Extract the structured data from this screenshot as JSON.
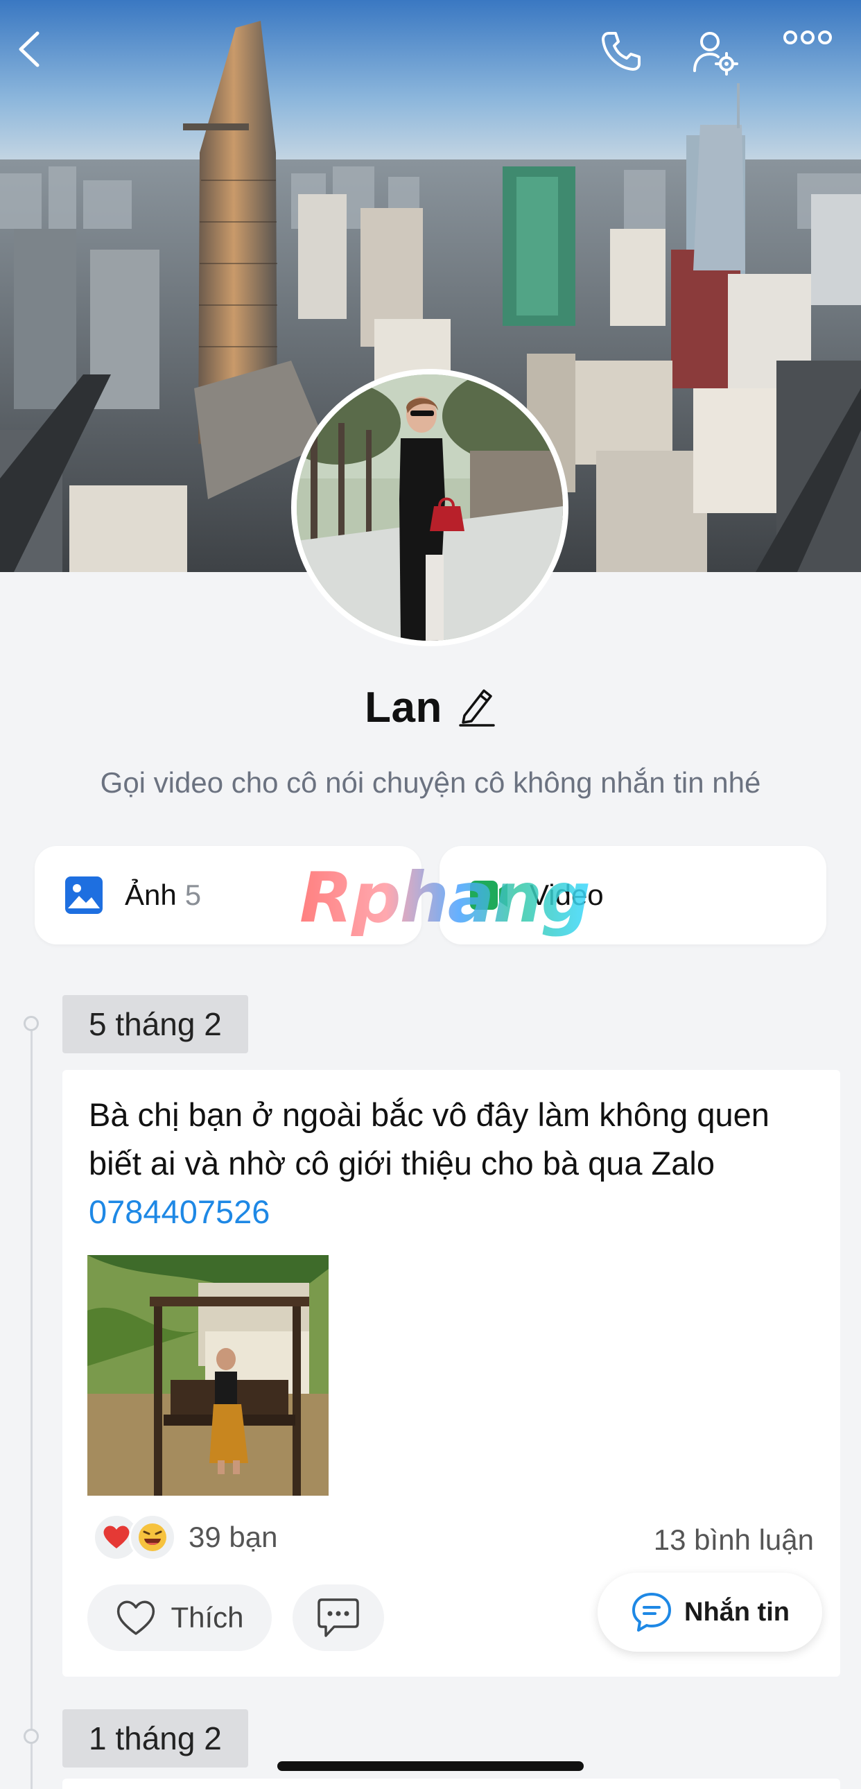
{
  "header": {
    "icons": [
      "chevron-left-icon",
      "phone-icon",
      "user-settings-icon",
      "more-dots-icon"
    ]
  },
  "profile": {
    "name": "Lan",
    "status": "Gọi video cho cô nói chuyện cô không nhắn tin nhé",
    "edit_icon": "pencil-icon"
  },
  "media": {
    "photos_label": "Ảnh",
    "photos_count": "5",
    "videos_label": "Video"
  },
  "watermark": "Rphang",
  "timeline": {
    "date_1": "5 tháng 2",
    "date_2": "1 tháng 2"
  },
  "post": {
    "text": "Bà chị bạn ở ngoài bắc vô đây làm không quen biết ai và nhờ cô giới thiệu cho bà qua Zalo ",
    "phone": "0784407526",
    "reactions": [
      "heart",
      "laugh"
    ],
    "reaction_count": "39 bạn",
    "comment_count": "13 bình luận",
    "like_label": "Thích"
  },
  "fab": {
    "message_label": "Nhắn tin"
  },
  "colors": {
    "accent": "#1e88e5",
    "background": "#f3f4f6",
    "heart": "#e53935"
  }
}
